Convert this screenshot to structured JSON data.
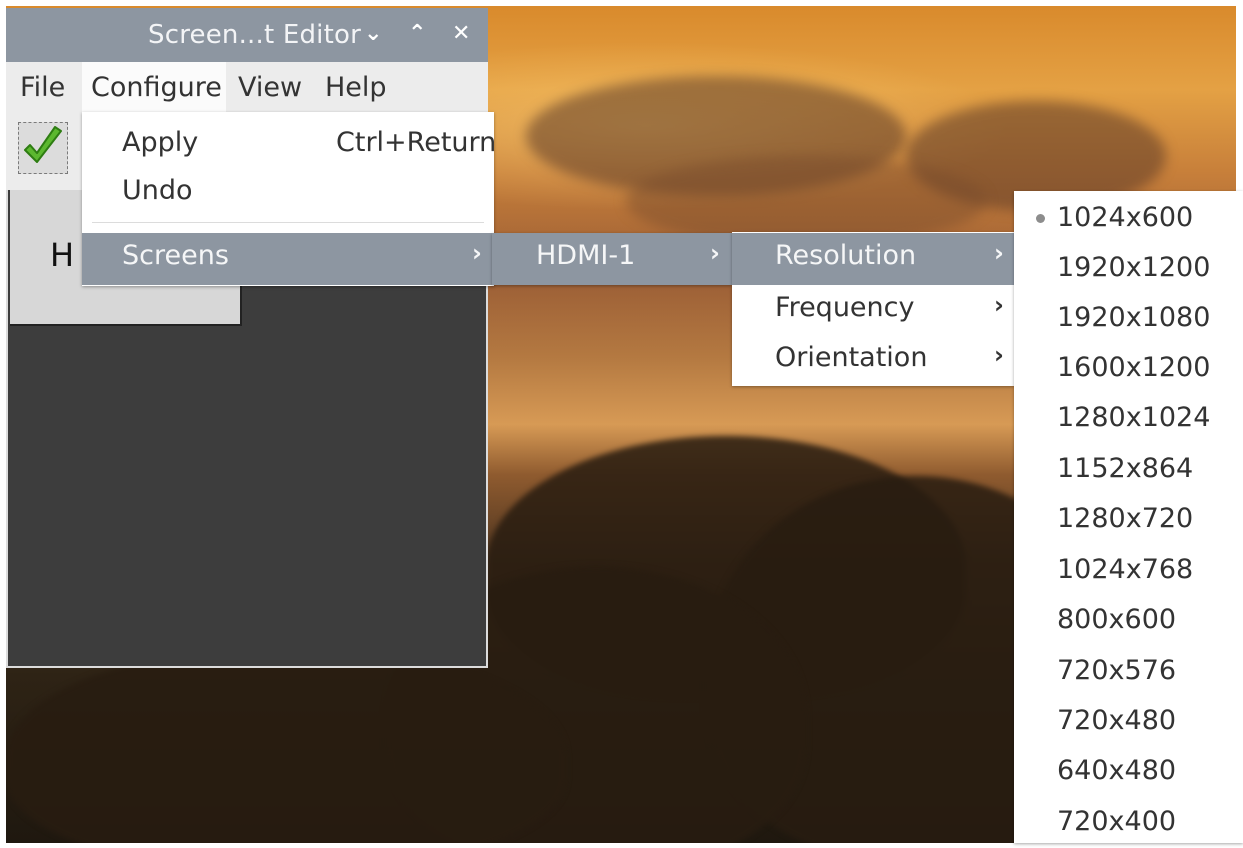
{
  "window": {
    "title": "Screen...t Editor",
    "controls": {
      "minimize": "⌄",
      "maximize": "⌃",
      "close": "✕"
    }
  },
  "menubar": {
    "items": [
      "File",
      "Configure",
      "View",
      "Help"
    ]
  },
  "toolbar": {
    "apply_icon": "checkmark-icon"
  },
  "layout_area": {
    "monitor_label": "H"
  },
  "configure_menu": {
    "apply": {
      "label": "Apply",
      "shortcut": "Ctrl+Return"
    },
    "undo": {
      "label": "Undo"
    },
    "screens": {
      "label": "Screens"
    }
  },
  "screens_submenu": {
    "hdmi": "HDMI-1"
  },
  "hdmi_submenu": {
    "items": [
      {
        "label": "Resolution",
        "selected": true
      },
      {
        "label": "Frequency",
        "selected": false
      },
      {
        "label": "Orientation",
        "selected": false
      }
    ]
  },
  "resolution_submenu": {
    "current": "1024x600",
    "options": [
      "1024x600",
      "1920x1200",
      "1920x1080",
      "1600x1200",
      "1280x1024",
      "1152x864",
      "1280x720",
      "1024x768",
      "800x600",
      "720x576",
      "720x480",
      "640x480",
      "720x400"
    ]
  },
  "colors": {
    "highlight": "#8d96a1",
    "menu_bg": "#ffffff",
    "menubar_bg": "#ececec",
    "workspace_bg": "#3d3d3d"
  }
}
